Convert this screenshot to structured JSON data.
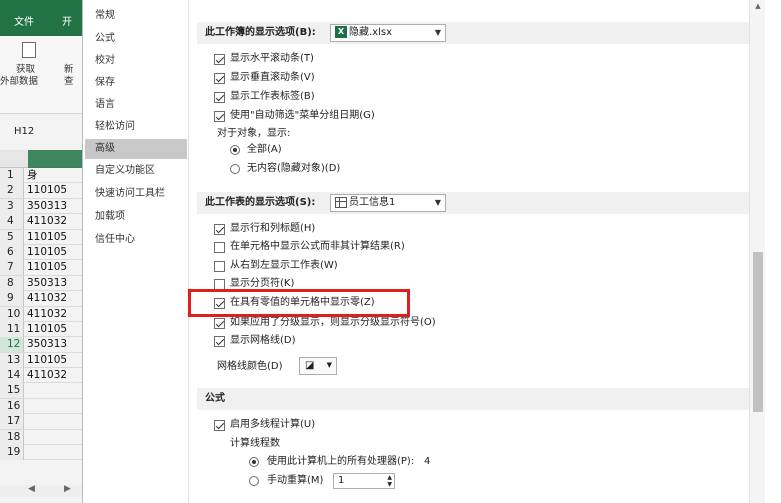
{
  "excel": {
    "tabs": [
      "文件",
      "开"
    ],
    "ribbon": {
      "get_data_label_1": "获取",
      "get_data_label_2": "外部数据",
      "next_label_1": "新",
      "next_label_2": "查"
    },
    "namebox": "H12",
    "rows": [
      {
        "num": "1",
        "value": "身"
      },
      {
        "num": "2",
        "value": "110105"
      },
      {
        "num": "3",
        "value": "350313"
      },
      {
        "num": "4",
        "value": "411032"
      },
      {
        "num": "5",
        "value": "110105"
      },
      {
        "num": "6",
        "value": "110105"
      },
      {
        "num": "7",
        "value": "110105"
      },
      {
        "num": "8",
        "value": "350313"
      },
      {
        "num": "9",
        "value": "411032"
      },
      {
        "num": "10",
        "value": "411032"
      },
      {
        "num": "11",
        "value": "110105"
      },
      {
        "num": "12",
        "value": "350313"
      },
      {
        "num": "13",
        "value": "110105"
      },
      {
        "num": "14",
        "value": "411032"
      },
      {
        "num": "15",
        "value": ""
      },
      {
        "num": "16",
        "value": ""
      },
      {
        "num": "17",
        "value": ""
      },
      {
        "num": "18",
        "value": ""
      },
      {
        "num": "19",
        "value": ""
      }
    ],
    "selected_row": "12"
  },
  "nav": {
    "items": [
      "常规",
      "公式",
      "校对",
      "保存",
      "语言",
      "轻松访问",
      "高级",
      "自定义功能区",
      "快速访问工具栏",
      "加载项",
      "信任中心"
    ],
    "active": "高级"
  },
  "workbook_section": {
    "title": "此工作簿的显示选项(B):",
    "workbook": "隐藏.xlsx",
    "options": [
      {
        "label": "显示水平滚动条(T)",
        "checked": true
      },
      {
        "label": "显示垂直滚动条(V)",
        "checked": true
      },
      {
        "label": "显示工作表标签(B)",
        "checked": true
      },
      {
        "label": "使用\"自动筛选\"菜单分组日期(G)",
        "checked": true
      }
    ],
    "objects_label": "对于对象，显示:",
    "radios": [
      {
        "label": "全部(A)",
        "selected": true
      },
      {
        "label": "无内容(隐藏对象)(D)",
        "selected": false
      }
    ]
  },
  "sheet_section": {
    "title": "此工作表的显示选项(S):",
    "sheet": "员工信息1",
    "options": [
      {
        "label": "显示行和列标题(H)",
        "checked": true
      },
      {
        "label": "在单元格中显示公式而非其计算结果(R)",
        "checked": false
      },
      {
        "label": "从右到左显示工作表(W)",
        "checked": false
      },
      {
        "label": "显示分页符(K)",
        "checked": false
      },
      {
        "label": "在具有零值的单元格中显示零(Z)",
        "checked": true
      },
      {
        "label": "如果应用了分级显示，则显示分级显示符号(O)",
        "checked": true
      },
      {
        "label": "显示网格线(D)",
        "checked": true
      }
    ],
    "gridline_color_label": "网格线颜色(D)"
  },
  "formula_section": {
    "title": "公式",
    "multithread_label": "启用多线程计算(U)",
    "multithread_checked": true,
    "thread_count_label": "计算线程数",
    "radios": [
      {
        "label": "使用此计算机上的所有处理器(P):",
        "selected": true,
        "value": "4"
      },
      {
        "label": "手动重算(M)",
        "selected": false,
        "value": "1"
      }
    ]
  },
  "colors": {
    "excel_green": "#217346",
    "highlight_red": "#e01e1e"
  }
}
